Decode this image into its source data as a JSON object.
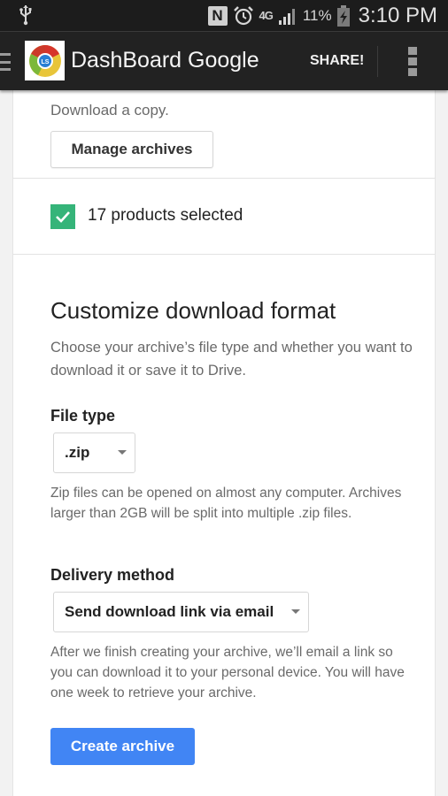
{
  "status_bar": {
    "usb_icon": "usb-icon",
    "nfc_label": "N",
    "alarm_icon": "alarm-clock-icon",
    "network_label": "4G",
    "signal_icon": "signal-bars-icon",
    "battery_percent": "11%",
    "battery_icon": "battery-charging-icon",
    "time": "3:10 PM"
  },
  "action_bar": {
    "menu_icon": "hamburger-icon",
    "app_icon": "dashboard-logo",
    "title": "DashBoard Google",
    "share_label": "SHARE!",
    "overflow_icon": "overflow-menu-icon"
  },
  "archive_section": {
    "download_text": "Download a copy.",
    "manage_button": "Manage archives"
  },
  "products": {
    "checked": true,
    "label": "17 products selected",
    "accent_color": "#35b479"
  },
  "customize": {
    "title": "Customize download format",
    "description": "Choose your archive’s file type and whether you want to download it or save it to Drive.",
    "file_type": {
      "label": "File type",
      "selected": ".zip",
      "help": "Zip files can be opened on almost any computer. Archives larger than 2GB will be split into multiple .zip files."
    },
    "delivery": {
      "label": "Delivery method",
      "selected": "Send download link via email",
      "help": "After we finish creating your archive, we’ll email a link so you can download it to your personal device. You will have one week to retrieve your archive."
    },
    "create_button": "Create archive",
    "button_color": "#4185f4"
  }
}
